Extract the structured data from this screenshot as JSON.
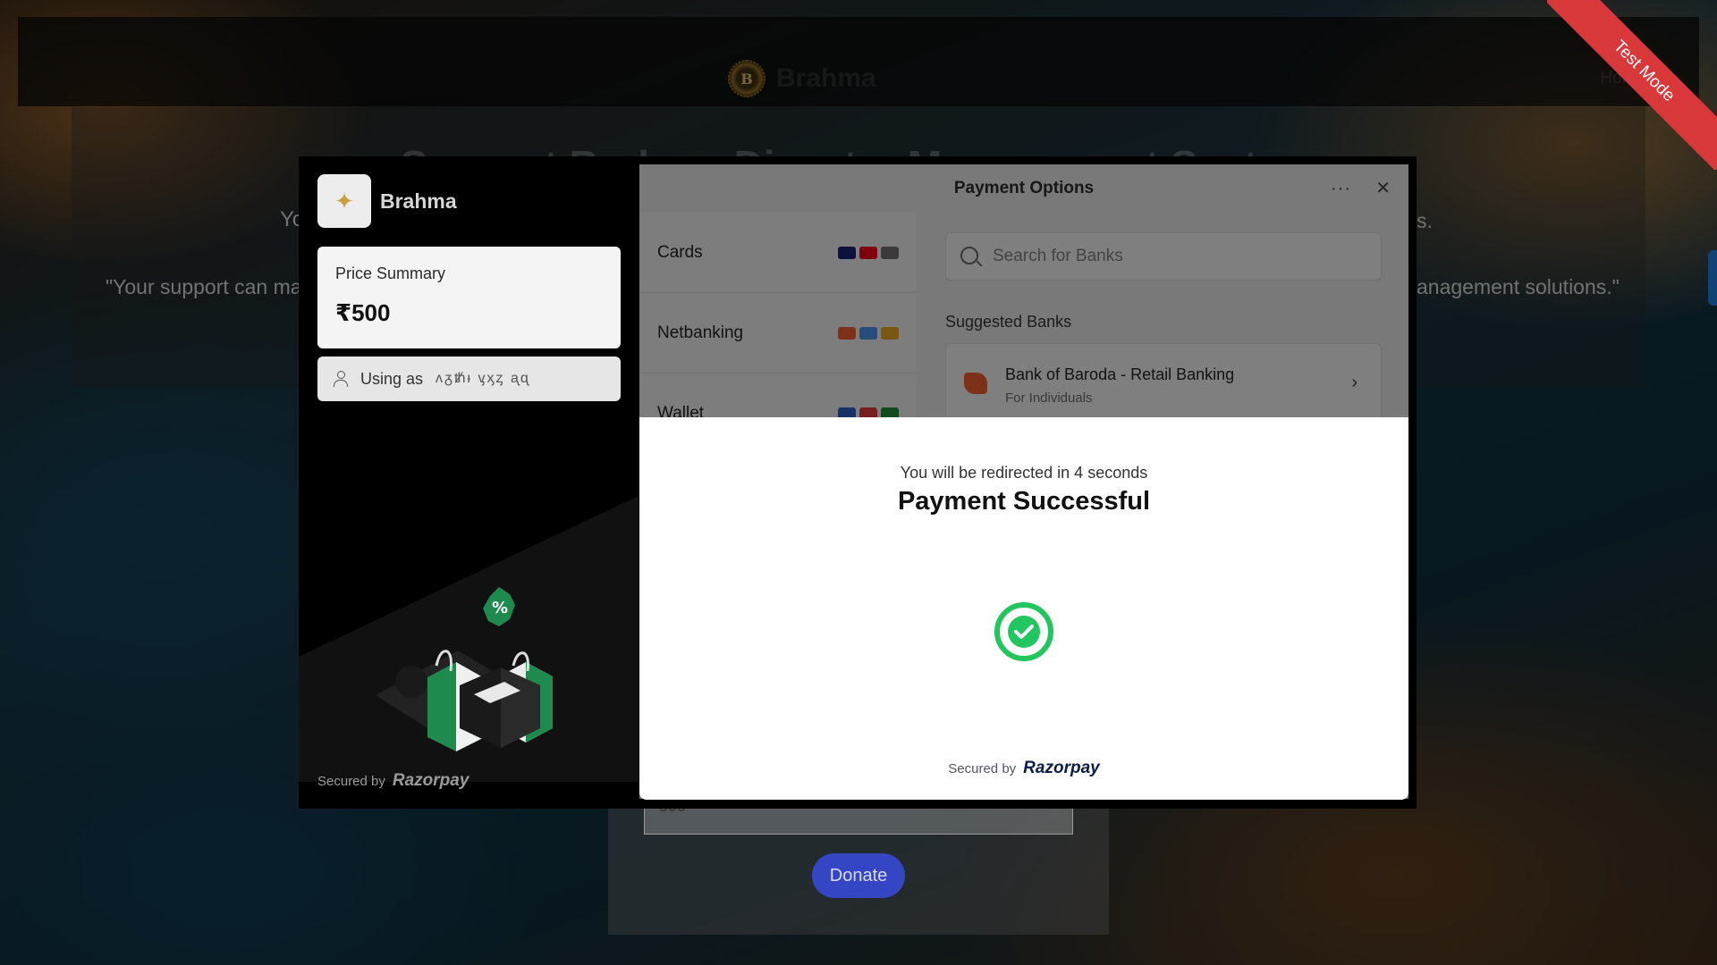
{
  "site": {
    "brand_name": "Brahma",
    "brand_logo_letter": "B",
    "nav_home": "Home",
    "ribbon": "Test Mode",
    "page_title": "Support Brahma Disaster Management System",
    "left_text": "Yo",
    "right_text": "s.",
    "quote_left": "\"Your support can ma",
    "quote_right": "anagement solutions.\"",
    "amount_value": "500",
    "donate_label": "Donate"
  },
  "checkout": {
    "merchant_name": "Brahma",
    "price_summary_label": "Price Summary",
    "price_value": "₹500",
    "using_as_label": "Using as",
    "using_as_masked": "ᴧᵹᵺᵻ ᶌᶍᶎ ᶏᶐ",
    "secured_by": "Secured by",
    "razorpay": "Razorpay",
    "options_title": "Payment Options",
    "more_icon": "···",
    "close_icon": "✕",
    "methods": [
      {
        "label": "Cards",
        "logos": [
          "#1a1f71",
          "#eb001b",
          "#6c6c6c"
        ]
      },
      {
        "label": "Netbanking",
        "logos": [
          "#e45a2c",
          "#4a8de0",
          "#e0a020"
        ]
      },
      {
        "label": "Wallet",
        "logos": [
          "#2b5cb8",
          "#d9383a",
          "#1f8a3a"
        ]
      }
    ],
    "search_placeholder": "Search for Banks",
    "suggested_label": "Suggested Banks",
    "bank": {
      "name": "Bank of Baroda - Retail Banking",
      "sub": "For Individuals"
    }
  },
  "success": {
    "redirect_text": "You will be redirected in 4 seconds",
    "title": "Payment Successful",
    "secured_by": "Secured by",
    "razorpay": "Razorpay",
    "status_color": "#22c55e"
  }
}
